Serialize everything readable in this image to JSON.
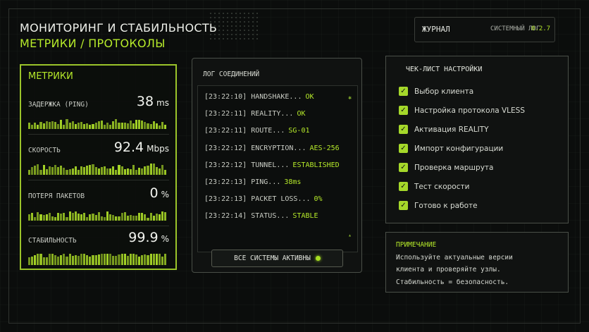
{
  "header": {
    "title": "МОНИТОРИНГ И СТАБИЛЬНОСТЬ",
    "subtitle": "МЕТРИКИ / ПРОТОКОЛЫ"
  },
  "journal": {
    "label": "ЖУРНАЛ",
    "system_log": "СИСТЕМНЫЙ ЛОГ",
    "version": "0.2.7"
  },
  "metrics": {
    "title": "МЕТРИКИ",
    "items": [
      {
        "label": "ЗАДЕРЖКА (PING)",
        "value": "38",
        "unit": "ms",
        "level": 0.6
      },
      {
        "label": "СКОРОСТЬ",
        "value": "92.4",
        "unit": "Mbps",
        "level": 0.7
      },
      {
        "label": "ПОТЕРЯ ПАКЕТОВ",
        "value": "0",
        "unit": "%",
        "level": 0.55
      },
      {
        "label": "СТАБИЛЬНОСТЬ",
        "value": "99.9",
        "unit": "%",
        "level": 0.95
      }
    ]
  },
  "log": {
    "title": "ЛОГ СОЕДИНЕНИЙ",
    "lines": [
      {
        "text": "[23:22:10] HANDSHAKE...",
        "status": "OK"
      },
      {
        "text": "[23:22:11] REALITY...",
        "status": "OK"
      },
      {
        "text": "[23:22:11] ROUTE...",
        "status": "SG-01"
      },
      {
        "text": "[23:22:12] ENCRYPTION...",
        "status": "AES-256"
      },
      {
        "text": "[23:22:12] TUNNEL...",
        "status": "ESTABLISHED"
      },
      {
        "text": "[23:22:13] PING...",
        "status": "38ms"
      },
      {
        "text": "[23:22:13] PACKET LOSS...",
        "status": "0%"
      },
      {
        "text": "[23:22:14] STATUS...",
        "status": "STABLE"
      }
    ],
    "button_label": "ВСЕ СИСТЕМЫ АКТИВНЫ"
  },
  "checklist": {
    "title": "ЧЕК-ЛИСТ НАСТРОЙКИ",
    "items": [
      {
        "label": "Выбор клиента",
        "checked": true
      },
      {
        "label": "Настройка протокола VLESS",
        "checked": true
      },
      {
        "label": "Активация REALITY",
        "checked": true
      },
      {
        "label": "Импорт конфигурации",
        "checked": true
      },
      {
        "label": "Проверка маршрута",
        "checked": true
      },
      {
        "label": "Тест скорости",
        "checked": true
      },
      {
        "label": "Готово к работе",
        "checked": true
      }
    ]
  },
  "note": {
    "title": "ПРИМЕЧАНИЕ",
    "lines": [
      "Используйте актуальные версии",
      "клиента и проверяйте узлы.",
      "Стабильность = безопасность."
    ]
  },
  "colors": {
    "accent": "#b6ea2a",
    "background": "#0b0d0c",
    "panel": "#101211"
  }
}
